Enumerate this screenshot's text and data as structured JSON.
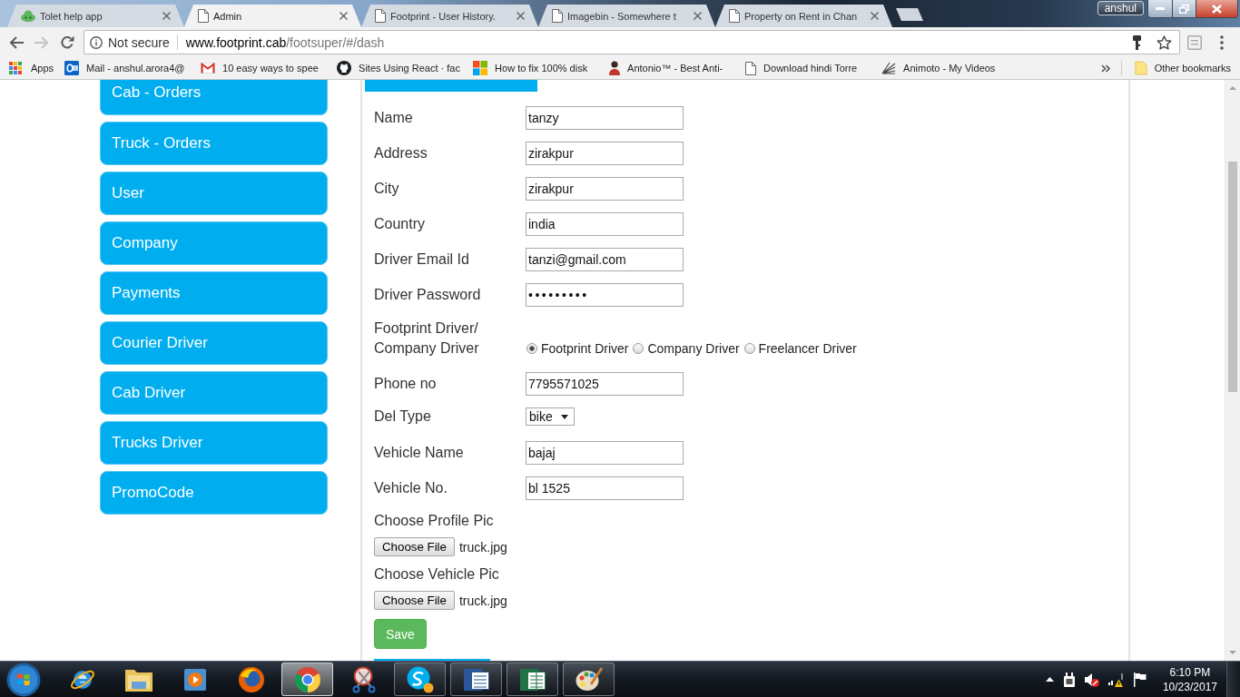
{
  "browser": {
    "tabs": [
      {
        "kind": "app",
        "title": "Tolet help app",
        "selected": false
      },
      {
        "kind": "page",
        "title": "Admin",
        "selected": true
      },
      {
        "kind": "page",
        "title": "Footprint - User History.",
        "selected": false
      },
      {
        "kind": "page",
        "title": "Imagebin - Somewhere t",
        "selected": false
      },
      {
        "kind": "page",
        "title": "Property on Rent in Chan",
        "selected": false
      }
    ],
    "profile": "anshul",
    "navigation": [
      {
        "kind": "back",
        "disabled": false
      },
      {
        "kind": "forward",
        "disabled": true
      },
      {
        "kind": "reload",
        "disabled": false
      }
    ],
    "address_bar": {
      "security": "Not secure",
      "host": "www.footprint.cab",
      "path": "/footsuper/#/dash"
    },
    "bookmarks": [
      {
        "kind": "apps",
        "title": "Apps"
      },
      {
        "kind": "mail",
        "title": "Mail - anshul.arora4@"
      },
      {
        "kind": "envelope",
        "title": "10 easy ways to spee"
      },
      {
        "kind": "cat",
        "title": "Sites Using React · fac"
      },
      {
        "kind": "tiles",
        "title": "How to fix 100% disk"
      },
      {
        "kind": "person",
        "title": "Antonio™ - Best Anti-"
      },
      {
        "kind": "page",
        "title": "Download hindi Torre"
      },
      {
        "kind": "fan",
        "title": "Animoto - My Videos"
      }
    ],
    "other_bookmarks": "Other bookmarks"
  },
  "sidebar": {
    "items": [
      {
        "label": "Cab - Orders"
      },
      {
        "label": "Truck - Orders"
      },
      {
        "label": "User"
      },
      {
        "label": "Company"
      },
      {
        "label": "Payments"
      },
      {
        "label": "Courier Driver"
      },
      {
        "label": "Cab Driver"
      },
      {
        "label": "Trucks Driver"
      },
      {
        "label": "PromoCode"
      }
    ]
  },
  "form": {
    "fields": [
      {
        "kind": "text",
        "label": "Name",
        "value": "tanzy"
      },
      {
        "kind": "text",
        "label": "Address",
        "value": "zirakpur"
      },
      {
        "kind": "text",
        "label": "City",
        "value": "zirakpur"
      },
      {
        "kind": "text",
        "label": "Country",
        "value": "india"
      },
      {
        "kind": "text",
        "label": "Driver Email Id",
        "value": "tanzi@gmail.com"
      },
      {
        "kind": "password",
        "label": "Driver Password",
        "value": "•••••••••"
      },
      {
        "kind": "radio",
        "label": "Footprint Driver/ Company Driver",
        "options": [
          {
            "label": "Footprint Driver",
            "selected": true
          },
          {
            "label": "Company Driver",
            "selected": false
          },
          {
            "label": "Freelancer Driver",
            "selected": false
          }
        ]
      },
      {
        "kind": "text",
        "label": "Phone no",
        "value": "7795571025"
      },
      {
        "kind": "select",
        "label": "Del Type",
        "value": "bike"
      },
      {
        "kind": "text",
        "label": "Vehicle Name",
        "value": "bajaj"
      },
      {
        "kind": "text",
        "label": "Vehicle No.",
        "value": "bl 1525"
      },
      {
        "kind": "file",
        "label": "Choose Profile Pic",
        "button": "Choose File",
        "file": "truck.jpg"
      },
      {
        "kind": "file",
        "label": "Choose Vehicle Pic",
        "button": "Choose File",
        "file": "truck.jpg"
      }
    ],
    "submit": "Save"
  },
  "taskbar": {
    "apps": [
      {
        "kind": "ie",
        "running": false,
        "selected": false
      },
      {
        "kind": "explorer",
        "running": false,
        "selected": false
      },
      {
        "kind": "media",
        "running": false,
        "selected": false
      },
      {
        "kind": "firefox",
        "running": false,
        "selected": false
      },
      {
        "kind": "chrome",
        "running": true,
        "selected": true
      },
      {
        "kind": "snipping",
        "running": false,
        "selected": false
      },
      {
        "kind": "skype",
        "running": true,
        "selected": false
      },
      {
        "kind": "word",
        "running": true,
        "selected": false
      },
      {
        "kind": "excel",
        "running": true,
        "selected": false
      },
      {
        "kind": "paint",
        "running": true,
        "selected": false
      }
    ],
    "clock": {
      "time": "6:10 PM",
      "date": "10/23/2017"
    }
  }
}
